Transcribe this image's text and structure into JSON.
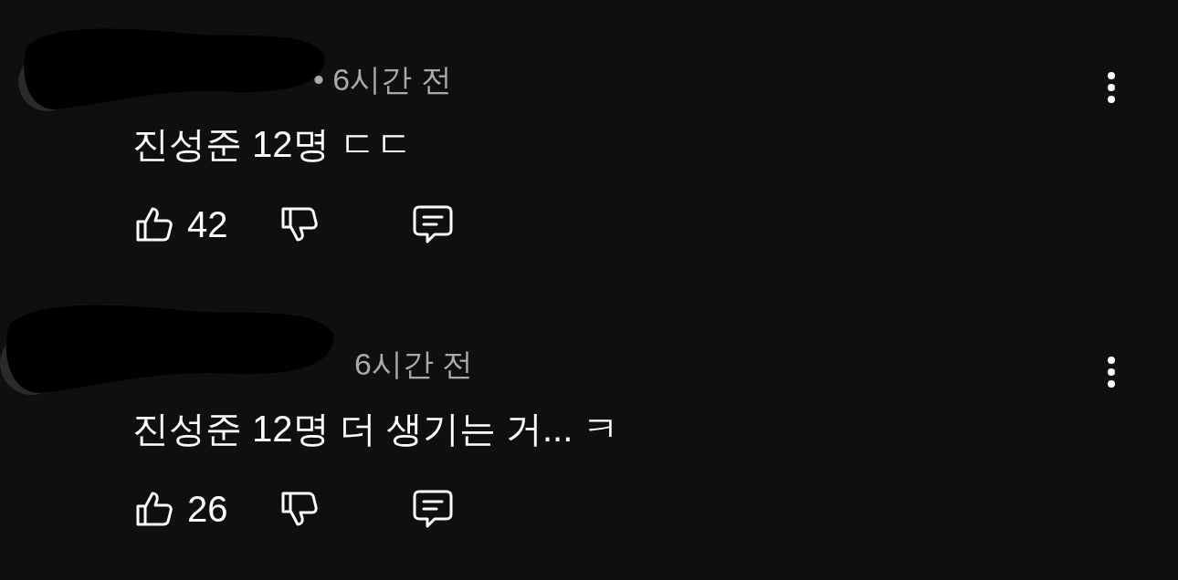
{
  "comments": [
    {
      "time": "• 6시간 전",
      "text": "진성준 12명 ㄷㄷ",
      "likes": "42"
    },
    {
      "time": "6시간 전",
      "text": "진성준 12명 더 생기는 거... ㅋ",
      "likes": "26"
    }
  ]
}
